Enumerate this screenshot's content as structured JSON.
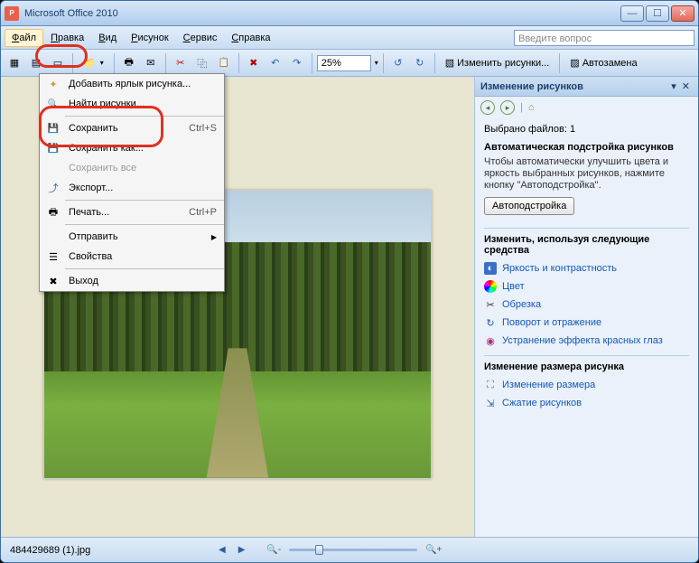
{
  "window": {
    "title": "Microsoft Office 2010"
  },
  "menubar": {
    "items": [
      {
        "label": "Файл",
        "u": "Ф"
      },
      {
        "label": "Правка",
        "u": "П"
      },
      {
        "label": "Вид",
        "u": "В"
      },
      {
        "label": "Рисунок",
        "u": "Р"
      },
      {
        "label": "Сервис",
        "u": "С"
      },
      {
        "label": "Справка",
        "u": "С"
      }
    ],
    "question_placeholder": "Введите вопрос"
  },
  "toolbar": {
    "zoom": "25%",
    "edit_label": "Изменить рисунки...",
    "auto_label": "Автозамена"
  },
  "filemenu": {
    "items": [
      {
        "icon": "star",
        "label": "Добавить ярлык рисунка...",
        "shortcut": "",
        "sub": false
      },
      {
        "icon": "find",
        "label": "Найти рисунки...",
        "shortcut": "",
        "sub": false,
        "sep": true
      },
      {
        "icon": "save",
        "label": "Сохранить",
        "shortcut": "Ctrl+S",
        "sub": false
      },
      {
        "icon": "save",
        "label": "Сохранить как...",
        "shortcut": "",
        "sub": false
      },
      {
        "icon": "",
        "label": "Сохранить все",
        "shortcut": "",
        "sub": false,
        "disabled": true
      },
      {
        "icon": "exp",
        "label": "Экспорт...",
        "shortcut": "",
        "sub": false,
        "sep": true
      },
      {
        "icon": "print",
        "label": "Печать...",
        "shortcut": "Ctrl+P",
        "sub": false,
        "sep": true
      },
      {
        "icon": "",
        "label": "Отправить",
        "shortcut": "",
        "sub": true
      },
      {
        "icon": "prop",
        "label": "Свойства",
        "shortcut": "",
        "sub": false,
        "sep": true
      },
      {
        "icon": "exit",
        "label": "Выход",
        "shortcut": "",
        "sub": false
      }
    ]
  },
  "pane": {
    "title": "Изменение рисунков",
    "selected": "Выбрано файлов: 1",
    "auto_hdr": "Автоматическая подстройка рисунков",
    "auto_desc": "Чтобы автоматически улучшить цвета и яркость выбранных рисунков, нажмите кнопку \"Автоподстройка\".",
    "auto_btn": "Автоподстройка",
    "tools_hdr": "Изменить, используя следующие средства",
    "tools": [
      "Яркость и контрастность",
      "Цвет",
      "Обрезка",
      "Поворот и отражение",
      "Устранение эффекта красных глаз"
    ],
    "size_hdr": "Изменение размера рисунка",
    "size_links": [
      "Изменение размера",
      "Сжатие рисунков"
    ]
  },
  "status": {
    "filename": "484429689 (1).jpg"
  }
}
